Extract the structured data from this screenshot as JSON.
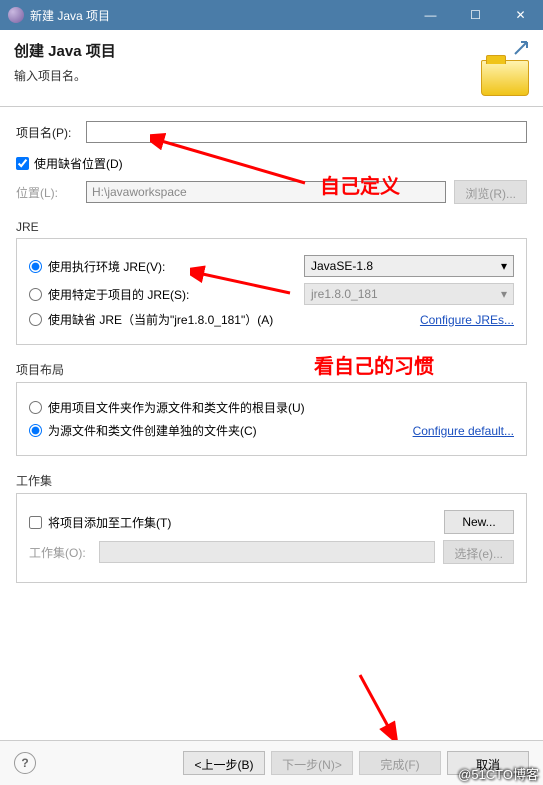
{
  "window": {
    "title": "新建 Java 项目",
    "minimize": "—",
    "maximize": "☐",
    "close": "✕"
  },
  "header": {
    "title": "创建 Java 项目",
    "subtitle": "输入项目名。"
  },
  "form": {
    "project_name_label": "项目名(P):",
    "project_name_value": "",
    "use_default_location_label": "使用缺省位置(D)",
    "use_default_location_checked": true,
    "location_label": "位置(L):",
    "location_value": "H:\\javaworkspace",
    "browse_button": "浏览(R)..."
  },
  "jre": {
    "legend": "JRE",
    "option_env_label": "使用执行环境 JRE(V):",
    "option_env_value": "JavaSE-1.8",
    "option_project_label": "使用特定于项目的 JRE(S):",
    "option_project_value": "jre1.8.0_181",
    "option_default_label": "使用缺省 JRE（当前为\"jre1.8.0_181\"）(A)",
    "configure_link": "Configure JREs..."
  },
  "layout": {
    "legend": "项目布局",
    "option_root_label": "使用项目文件夹作为源文件和类文件的根目录(U)",
    "option_separate_label": "为源文件和类文件创建单独的文件夹(C)",
    "configure_link": "Configure default..."
  },
  "working_sets": {
    "legend": "工作集",
    "add_checkbox_label": "将项目添加至工作集(T)",
    "new_button": "New...",
    "working_sets_label": "工作集(O):",
    "select_button": "选择(e)..."
  },
  "buttons": {
    "back": "<上一步(B)",
    "next": "下一步(N)>",
    "finish": "完成(F)",
    "cancel": "取消",
    "help": "?"
  },
  "annotations": {
    "define_yourself": "自己定义",
    "your_habit": "看自己的习惯",
    "brand": "@51CTO博客"
  }
}
